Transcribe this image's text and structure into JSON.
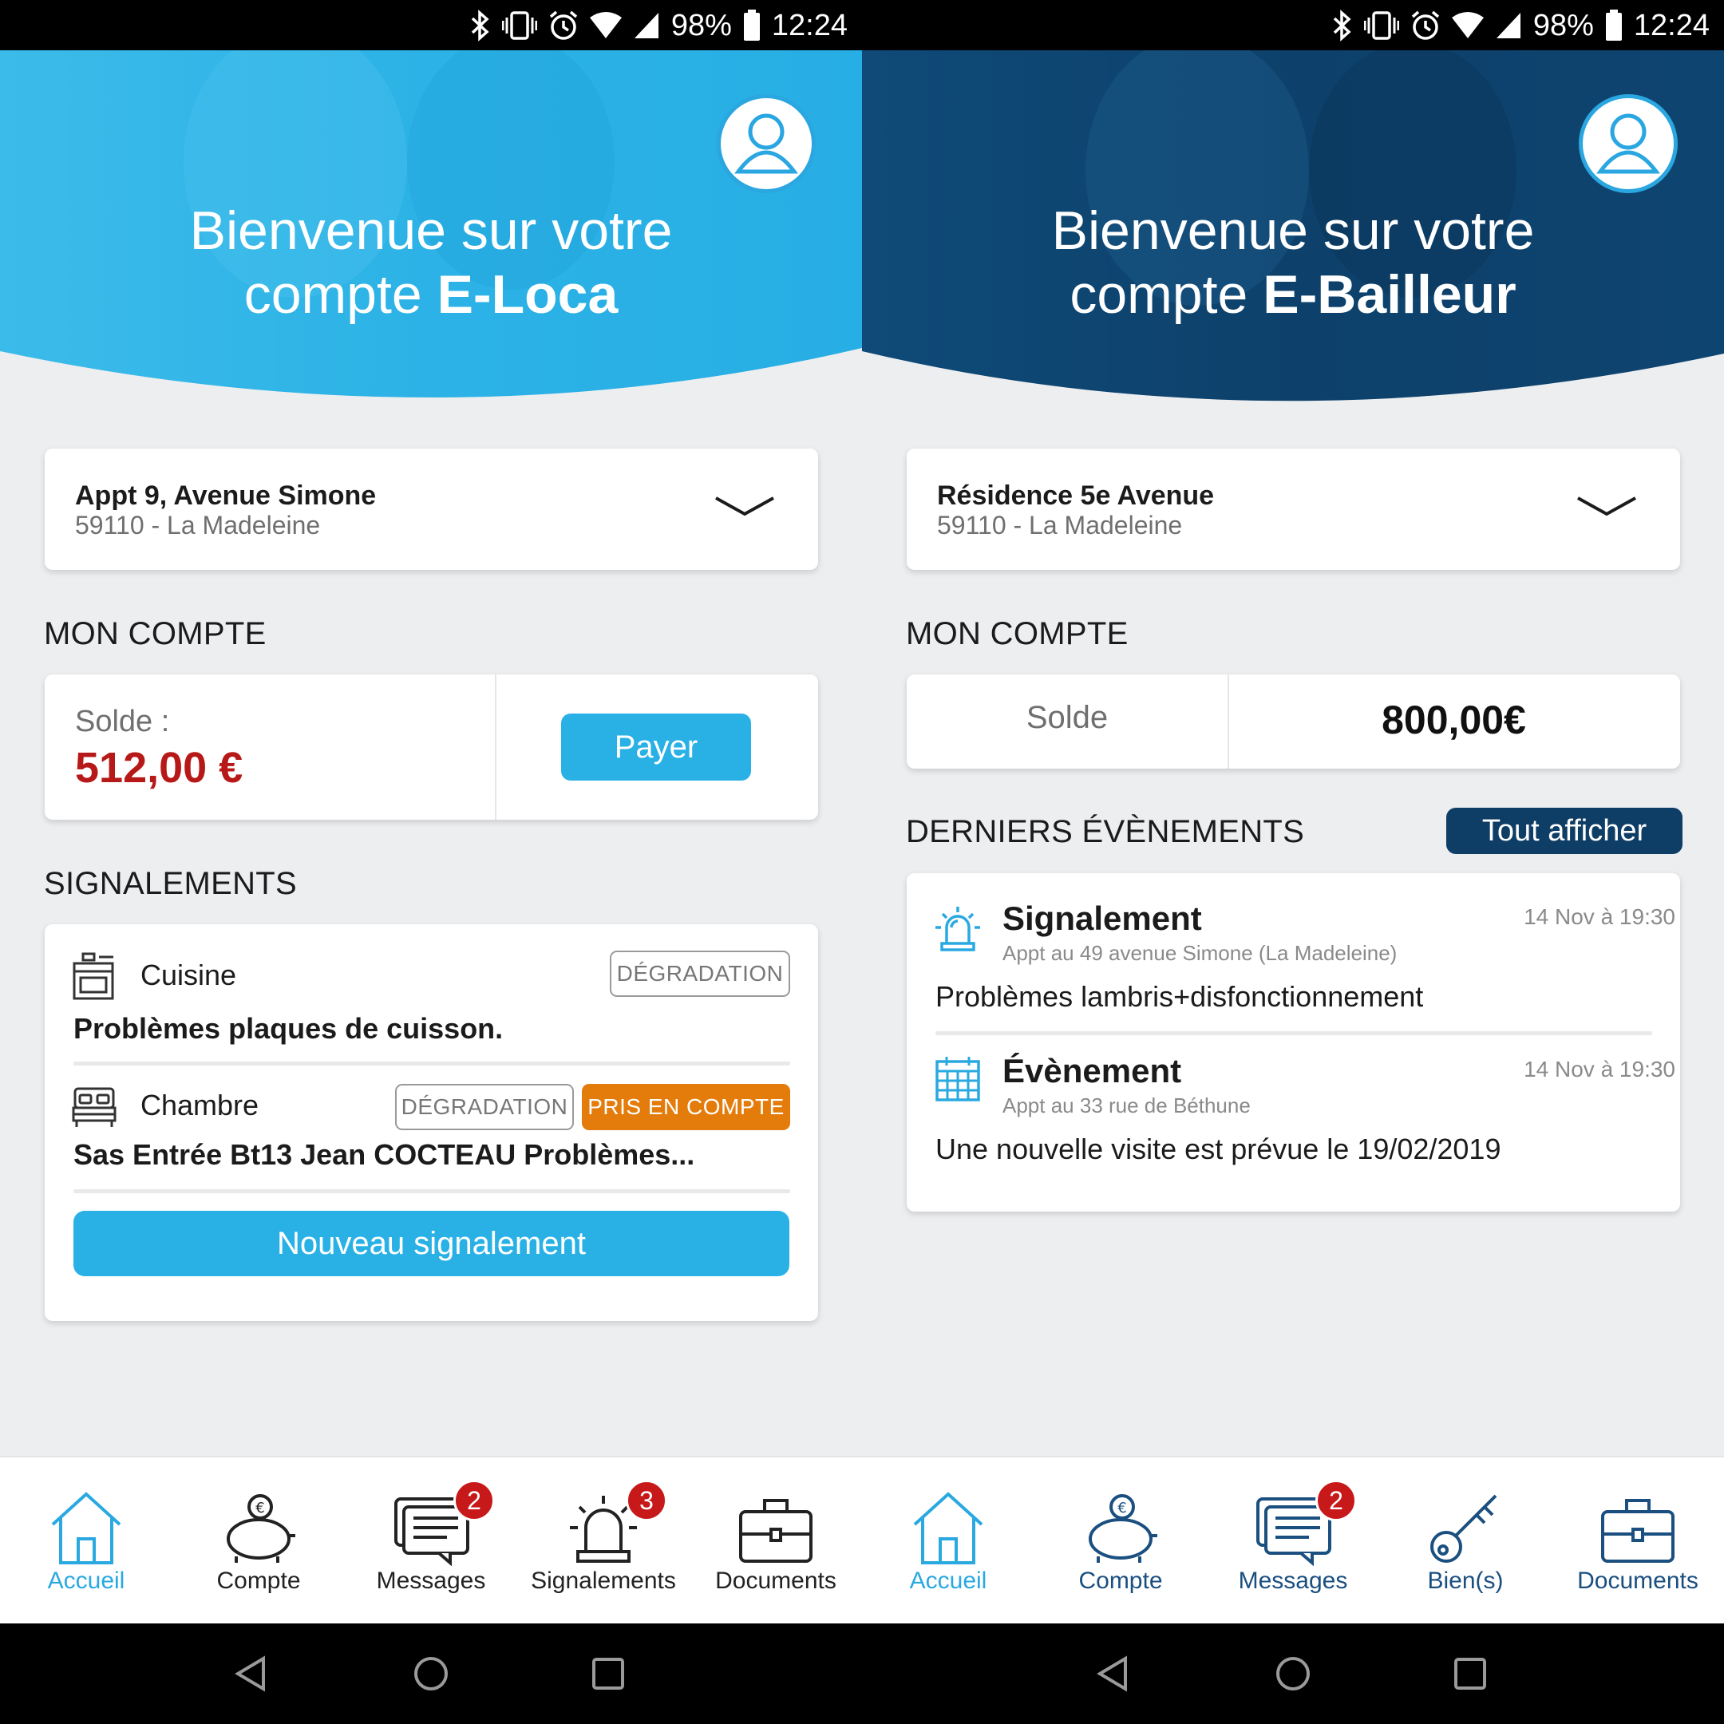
{
  "status_bar": {
    "battery": "98%",
    "time": "12:24"
  },
  "left": {
    "welcome_line1": "Bienvenue sur votre",
    "welcome_line2_prefix": "compte ",
    "welcome_line2_brand": "E-Loca",
    "address": {
      "title": "Appt 9, Avenue Simone",
      "subtitle": "59110 - La Madeleine"
    },
    "account_section": "MON COMPTE",
    "balance_label": "Solde :",
    "balance_value": "512,00 €",
    "pay_button": "Payer",
    "reports_section": "SIGNALEMENTS",
    "reports": [
      {
        "room": "Cuisine",
        "description": "Problèmes plaques de cuisson.",
        "tags": [
          "DÉGRADATION"
        ]
      },
      {
        "room": "Chambre",
        "description": "Sas Entrée Bt13 Jean COCTEAU Problèmes...",
        "tags": [
          "DÉGRADATION",
          "PRIS EN COMPTE"
        ]
      }
    ],
    "new_report_button": "Nouveau signalement",
    "nav": [
      {
        "label": "Accueil",
        "icon": "home-icon",
        "active": true
      },
      {
        "label": "Compte",
        "icon": "piggy-bank-icon"
      },
      {
        "label": "Messages",
        "icon": "messages-icon",
        "badge": "2"
      },
      {
        "label": "Signalements",
        "icon": "alarm-light-icon",
        "badge": "3"
      },
      {
        "label": "Documents",
        "icon": "briefcase-icon"
      }
    ]
  },
  "right": {
    "welcome_line1": "Bienvenue sur votre",
    "welcome_line2_prefix": "compte ",
    "welcome_line2_brand": "E-Bailleur",
    "address": {
      "title": "Résidence 5e Avenue",
      "subtitle": "59110 - La Madeleine"
    },
    "account_section": "MON COMPTE",
    "balance_label": "Solde",
    "balance_value": "800,00€",
    "events_section": "DERNIERS ÉVÈNEMENTS",
    "show_all_button": "Tout afficher",
    "events": [
      {
        "type": "Signalement",
        "subtitle": "Appt au 49 avenue Simone (La Madeleine)",
        "time": "14 Nov à 19:30",
        "text": "Problèmes lambris+disfonctionnement",
        "icon": "alarm-light-icon"
      },
      {
        "type": "Évènement",
        "subtitle": "Appt au 33 rue de Béthune",
        "time": "14 Nov à 19:30",
        "text": "Une nouvelle visite est prévue le 19/02/2019",
        "icon": "calendar-icon"
      }
    ],
    "nav": [
      {
        "label": "Accueil",
        "icon": "home-icon",
        "active": true
      },
      {
        "label": "Compte",
        "icon": "piggy-bank-icon"
      },
      {
        "label": "Messages",
        "icon": "messages-icon",
        "badge": "2"
      },
      {
        "label": "Bien(s)",
        "icon": "key-icon"
      },
      {
        "label": "Documents",
        "icon": "briefcase-icon"
      }
    ]
  },
  "colors": {
    "light_blue": "#29b1e6",
    "dark_blue": "#0e3d66",
    "balance_red": "#b71818",
    "tag_orange": "#e47c0c",
    "badge_red": "#c8191a"
  }
}
